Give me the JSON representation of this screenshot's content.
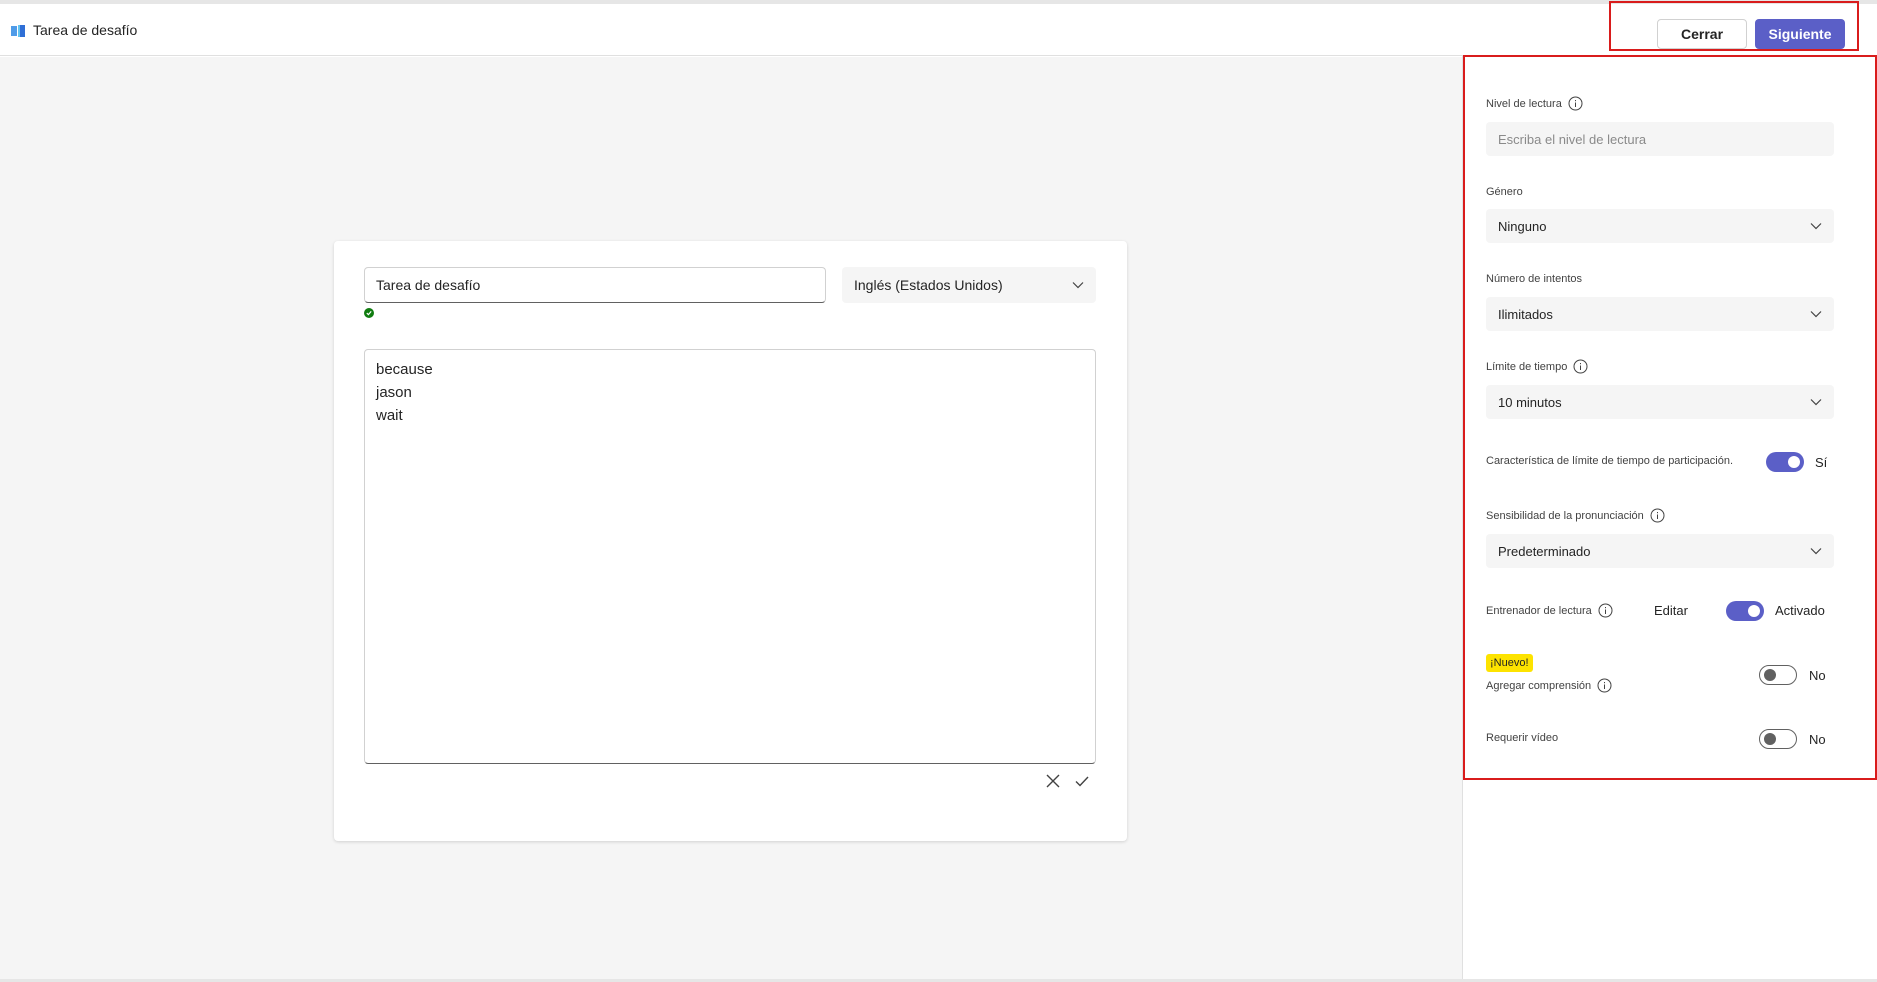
{
  "header": {
    "app_title": "Tarea de desafío",
    "close_label": "Cerrar",
    "next_label": "Siguiente"
  },
  "editor": {
    "title_value": "Tarea de desafío",
    "language_value": "Inglés (Estados Unidos)",
    "words": [
      "because",
      "jason",
      "wait"
    ]
  },
  "settings": {
    "reading_level": {
      "label": "Nivel de lectura",
      "placeholder": "Escriba el nivel de lectura"
    },
    "genre": {
      "label": "Género",
      "value": "Ninguno"
    },
    "attempts": {
      "label": "Número de intentos",
      "value": "Ilimitados"
    },
    "time_limit": {
      "label": "Límite de tiempo",
      "value": "10 minutos"
    },
    "participation_time_limit": {
      "label": "Característica de límite de tiempo de participación.",
      "enabled": true,
      "state_label": "Sí"
    },
    "pronunciation_sensitivity": {
      "label": "Sensibilidad de la pronunciación",
      "value": "Predeterminado"
    },
    "reading_coach": {
      "label": "Entrenador de lectura",
      "edit_label": "Editar",
      "enabled": true,
      "state_label": "Activado"
    },
    "comprehension": {
      "badge": "¡Nuevo!",
      "label": "Agregar comprensión",
      "enabled": false,
      "state_label": "No"
    },
    "require_video": {
      "label": "Requerir vídeo",
      "enabled": false,
      "state_label": "No"
    }
  },
  "colors": {
    "accent": "#5b5fc7",
    "highlight_border": "#d91c1c",
    "success": "#107c10",
    "new_badge": "#fde300"
  }
}
